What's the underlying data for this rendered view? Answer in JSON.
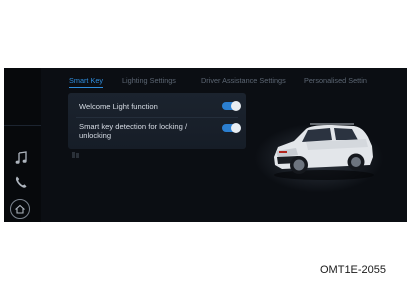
{
  "tabs": [
    {
      "label": "Smart Key",
      "active": true
    },
    {
      "label": "Lighting Settings",
      "active": false
    },
    {
      "label": "Driver Assistance Settings",
      "active": false
    },
    {
      "label": "Personalised Settin",
      "active": false
    }
  ],
  "settings": [
    {
      "label": "Welcome Light function",
      "enabled": true
    },
    {
      "label_line1": "Smart key detection for locking /",
      "label_line2": "unlocking",
      "enabled": true
    }
  ],
  "sidebar": {
    "icons": [
      "music-icon",
      "phone-icon",
      "home-icon"
    ]
  },
  "vehicle": {
    "color": "#e3e6ea",
    "accent": "#b3261e"
  },
  "colors": {
    "accent": "#2f8ddc",
    "toggle_on": "#2b7fd0",
    "background": "#0b0e13"
  },
  "caption": "OMT1E-2055"
}
